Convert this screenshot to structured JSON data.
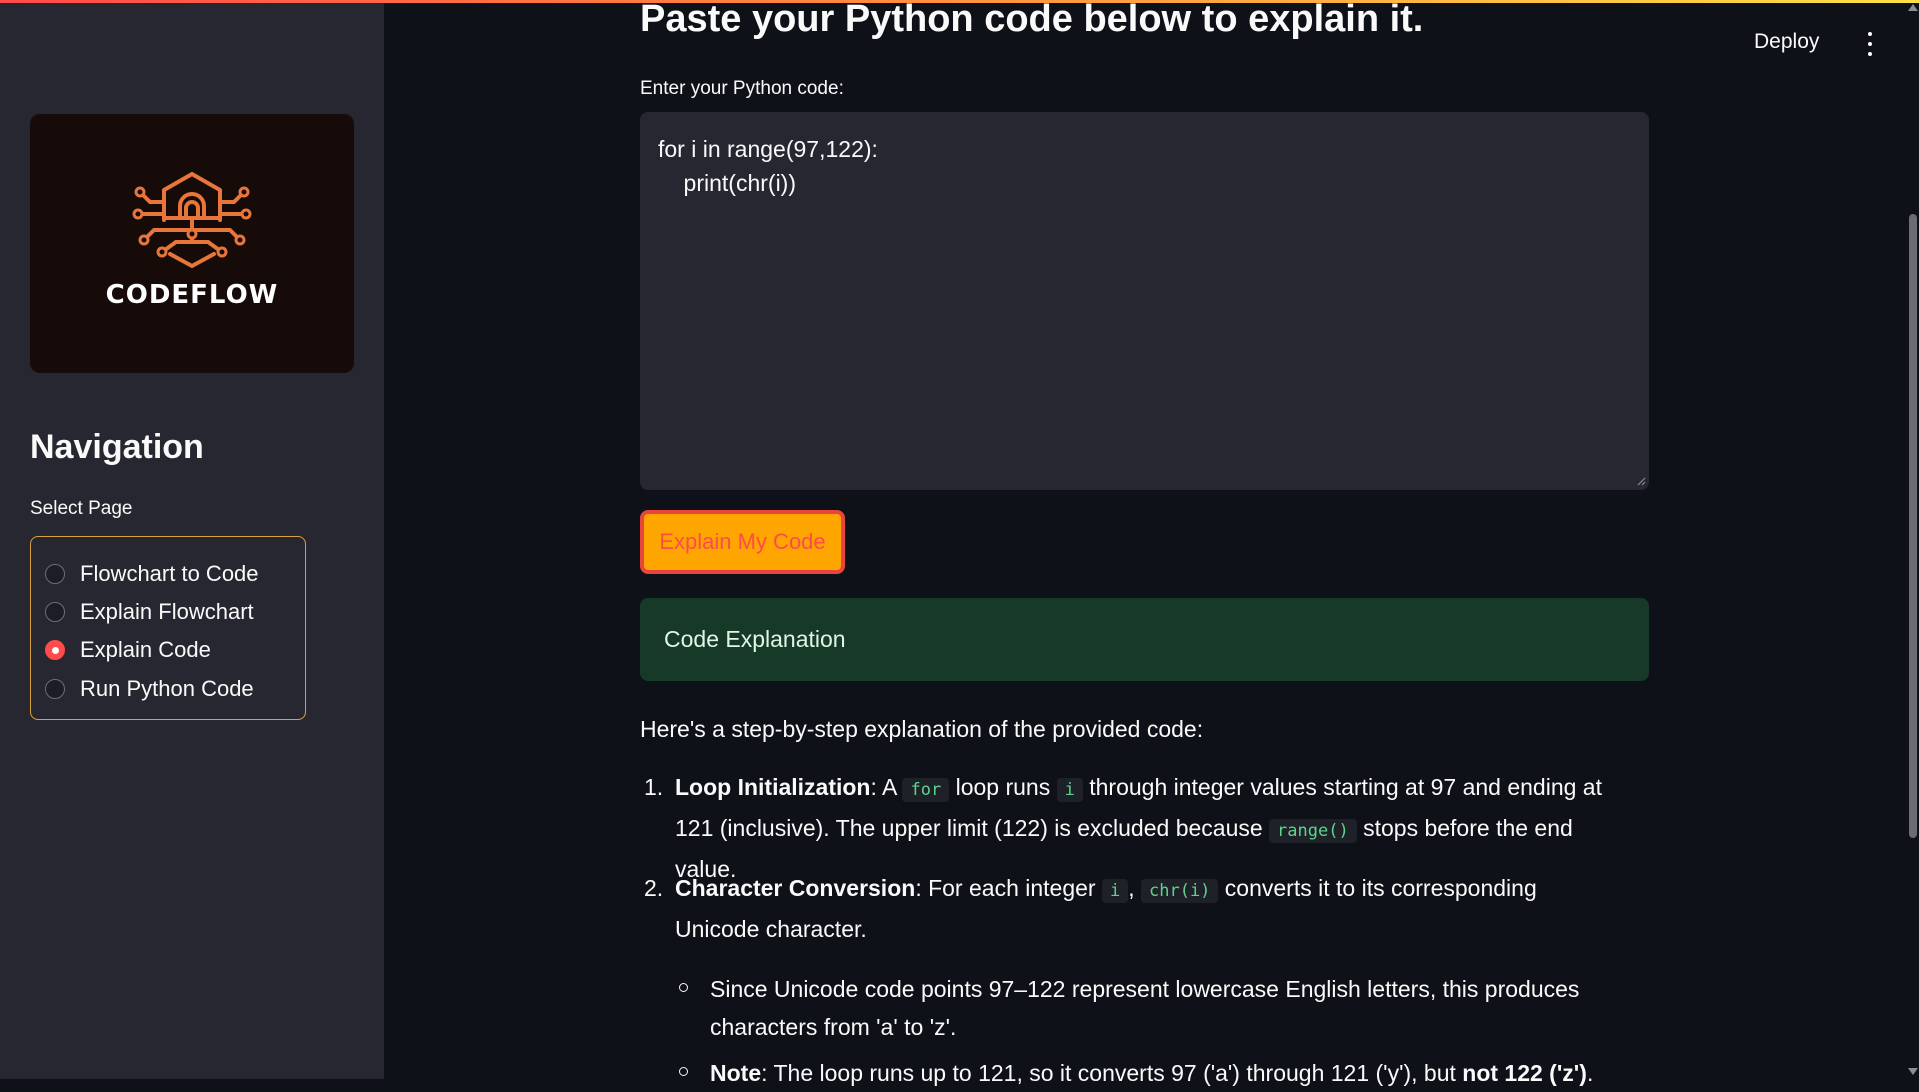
{
  "sidebar": {
    "logo_text": "CODEFLOW",
    "nav_title": "Navigation",
    "select_label": "Select Page",
    "pages": [
      {
        "label": "Flowchart to Code",
        "selected": false
      },
      {
        "label": "Explain Flowchart",
        "selected": false
      },
      {
        "label": "Explain Code",
        "selected": true
      },
      {
        "label": "Run Python Code",
        "selected": false
      }
    ]
  },
  "header": {
    "deploy_label": "Deploy",
    "menu_icon": "kebab-menu-icon"
  },
  "main": {
    "title": "Paste your Python code below to explain it.",
    "code_label": "Enter your Python code:",
    "code_value": "for i in range(97,122):\n    print(chr(i))",
    "button_label": "Explain My Code",
    "result_heading": "Code Explanation",
    "intro": "Here's a step-by-step explanation of the provided code:",
    "step1": {
      "num": "1.",
      "title": "Loop Initialization",
      "t1": ": A ",
      "c1": "for",
      "t2": " loop runs ",
      "c2": "i",
      "t3": " through integer values starting at 97 and ending at 121 (inclusive). The upper limit (122) is excluded because ",
      "c3": "range()",
      "t4": " stops before the end value."
    },
    "step2": {
      "num": "2.",
      "title": "Character Conversion",
      "t1": ": For each integer ",
      "c1": "i",
      "t2": ", ",
      "c2": "chr(i)",
      "t3": " converts it to its corresponding Unicode character."
    },
    "bullet1": "Since Unicode code points 97–122 represent lowercase English letters, this produces characters from 'a' to 'z'.",
    "bullet2": {
      "b1": "Note",
      "t1": ": The loop runs up to 121, so it converts 97 ('a') through 121 ('y'), but ",
      "b2": "not 122 ('z')",
      "t2": "."
    }
  },
  "colors": {
    "accent": "#ff4b4b",
    "button_bg": "#ffa500",
    "success_bg": "#173928",
    "code_green": "#5ed38c"
  }
}
